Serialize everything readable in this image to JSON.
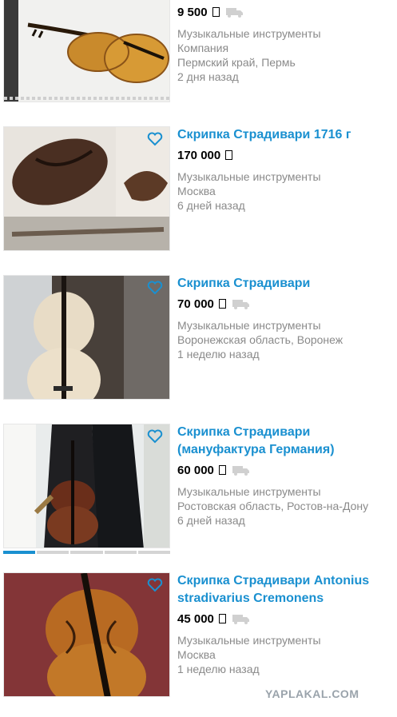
{
  "listings": [
    {
      "title": "",
      "price": "9 500",
      "category": "Музыкальные инструменты",
      "seller": "Компания",
      "location": "Пермский край, Пермь",
      "date": "2 дня назад",
      "favorite_icon": "heart-outline-icon",
      "delivery_icon": "truck-icon"
    },
    {
      "title": "Скрипка Страдивари 1716 г",
      "price": "170 000",
      "category": "Музыкальные инструменты",
      "location": "Москва",
      "date": "6 дней назад"
    },
    {
      "title": "Скрипка Страдивари",
      "price": "70 000",
      "category": "Музыкальные инструменты",
      "location": "Воронежская область, Воронеж",
      "date": "1 неделю назад"
    },
    {
      "title_line1": "Скрипка Страдивари",
      "title_line2": "(мануфактура Германия)",
      "price": "60 000",
      "category": "Музыкальные инструменты",
      "location": "Ростовская область, Ростов-на-Дону",
      "date": "6 дней назад",
      "image_count": 5,
      "active_image": 1
    },
    {
      "title_line1": "Скрипка Страдивари Antonius",
      "title_line2": "stradivarius Cremonens",
      "price": "45 000",
      "category": "Музыкальные инструменты",
      "location": "Москва",
      "date": "1 неделю назад"
    }
  ],
  "watermark": "YAPLAKAL.COM",
  "colors": {
    "link": "#1a90d0",
    "meta": "#8a8a8a",
    "icon": "#d0d0d0"
  }
}
